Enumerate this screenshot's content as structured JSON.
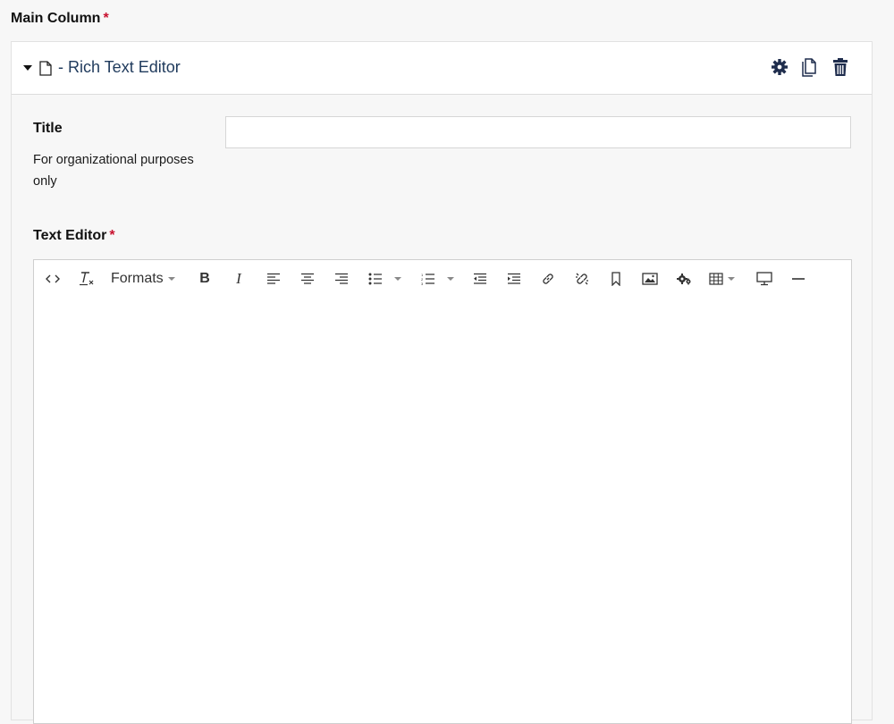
{
  "field": {
    "label": "Main Column",
    "required_mark": "*"
  },
  "block": {
    "title": "- Rich Text Editor",
    "actions": [
      "settings-icon",
      "duplicate-icon",
      "trash-icon"
    ]
  },
  "title_field": {
    "label": "Title",
    "help": "For organizational purposes only",
    "value": "",
    "placeholder": ""
  },
  "editor_field": {
    "label": "Text Editor",
    "required_mark": "*"
  },
  "toolbar": {
    "formats_label": "Formats",
    "bold_label": "B",
    "italic_label": "I"
  },
  "colors": {
    "accent": "#1f3a5c",
    "required": "#c8102e"
  }
}
